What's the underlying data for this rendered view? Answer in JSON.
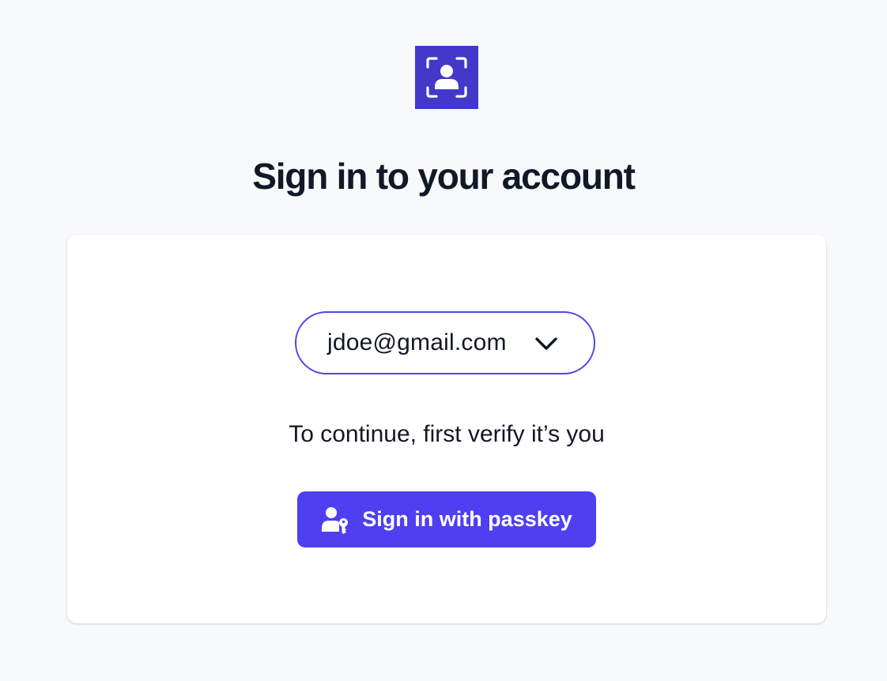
{
  "header": {
    "logo_icon": "user-scan-icon",
    "title": "Sign in to your account"
  },
  "card": {
    "account_select": {
      "value": "jdoe@gmail.com",
      "icon": "chevron-down-icon"
    },
    "prompt": "To continue, first verify it’s you",
    "passkey_button": {
      "label": "Sign in with passkey",
      "icon": "passkey-user-key-icon"
    }
  },
  "colors": {
    "background": "#f8f9fb",
    "logo": "#4338ca",
    "accent": "#4f46e5",
    "button": "#4f3ff0",
    "text": "#111827"
  }
}
